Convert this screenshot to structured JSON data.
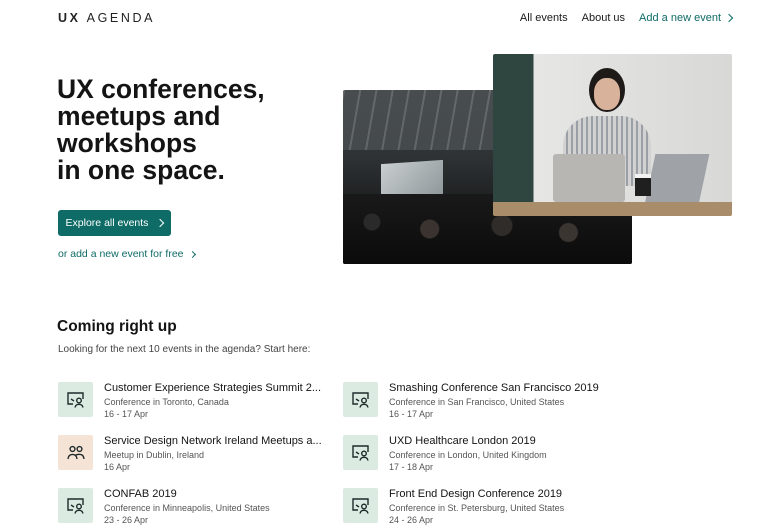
{
  "header": {
    "logo_bold": "UX",
    "logo_rest": "AGENDA",
    "nav": {
      "all_events": "All events",
      "about_us": "About us",
      "add_event": "Add a new event"
    }
  },
  "hero": {
    "title_lines": [
      "UX conferences,",
      "meetups and",
      "workshops",
      "in one space."
    ],
    "cta_label": "Explore all events",
    "secondary_link": "or add a new event for free"
  },
  "coming_up": {
    "title": "Coming right up",
    "subtitle": "Looking for the next 10 events in the agenda? Start here:",
    "events": [
      {
        "name": "Customer Experience Strategies Summit 2...",
        "meta": "Conference in Toronto, Canada",
        "date": "16 - 17 Apr",
        "kind": "conference"
      },
      {
        "name": "Smashing Conference San Francisco 2019",
        "meta": "Conference in San Francisco, United States",
        "date": "16 - 17 Apr",
        "kind": "conference"
      },
      {
        "name": "Service Design Network Ireland Meetups a...",
        "meta": "Meetup in Dublin, Ireland",
        "date": "16 Apr",
        "kind": "meetup"
      },
      {
        "name": "UXD Healthcare London 2019",
        "meta": "Conference in London, United Kingdom",
        "date": "17 - 18 Apr",
        "kind": "conference"
      },
      {
        "name": "CONFAB 2019",
        "meta": "Conference in Minneapolis, United States",
        "date": "23 - 26 Apr",
        "kind": "conference"
      },
      {
        "name": "Front End Design Conference 2019",
        "meta": "Conference in St. Petersburg, United States",
        "date": "24 - 26 Apr",
        "kind": "conference"
      }
    ]
  },
  "colors": {
    "accent": "#0e6b66",
    "conference_icon_bg": "#dbebe2",
    "meetup_icon_bg": "#f5e3d6"
  },
  "icons": {
    "conference": "presentation-person-icon",
    "meetup": "people-group-icon"
  }
}
